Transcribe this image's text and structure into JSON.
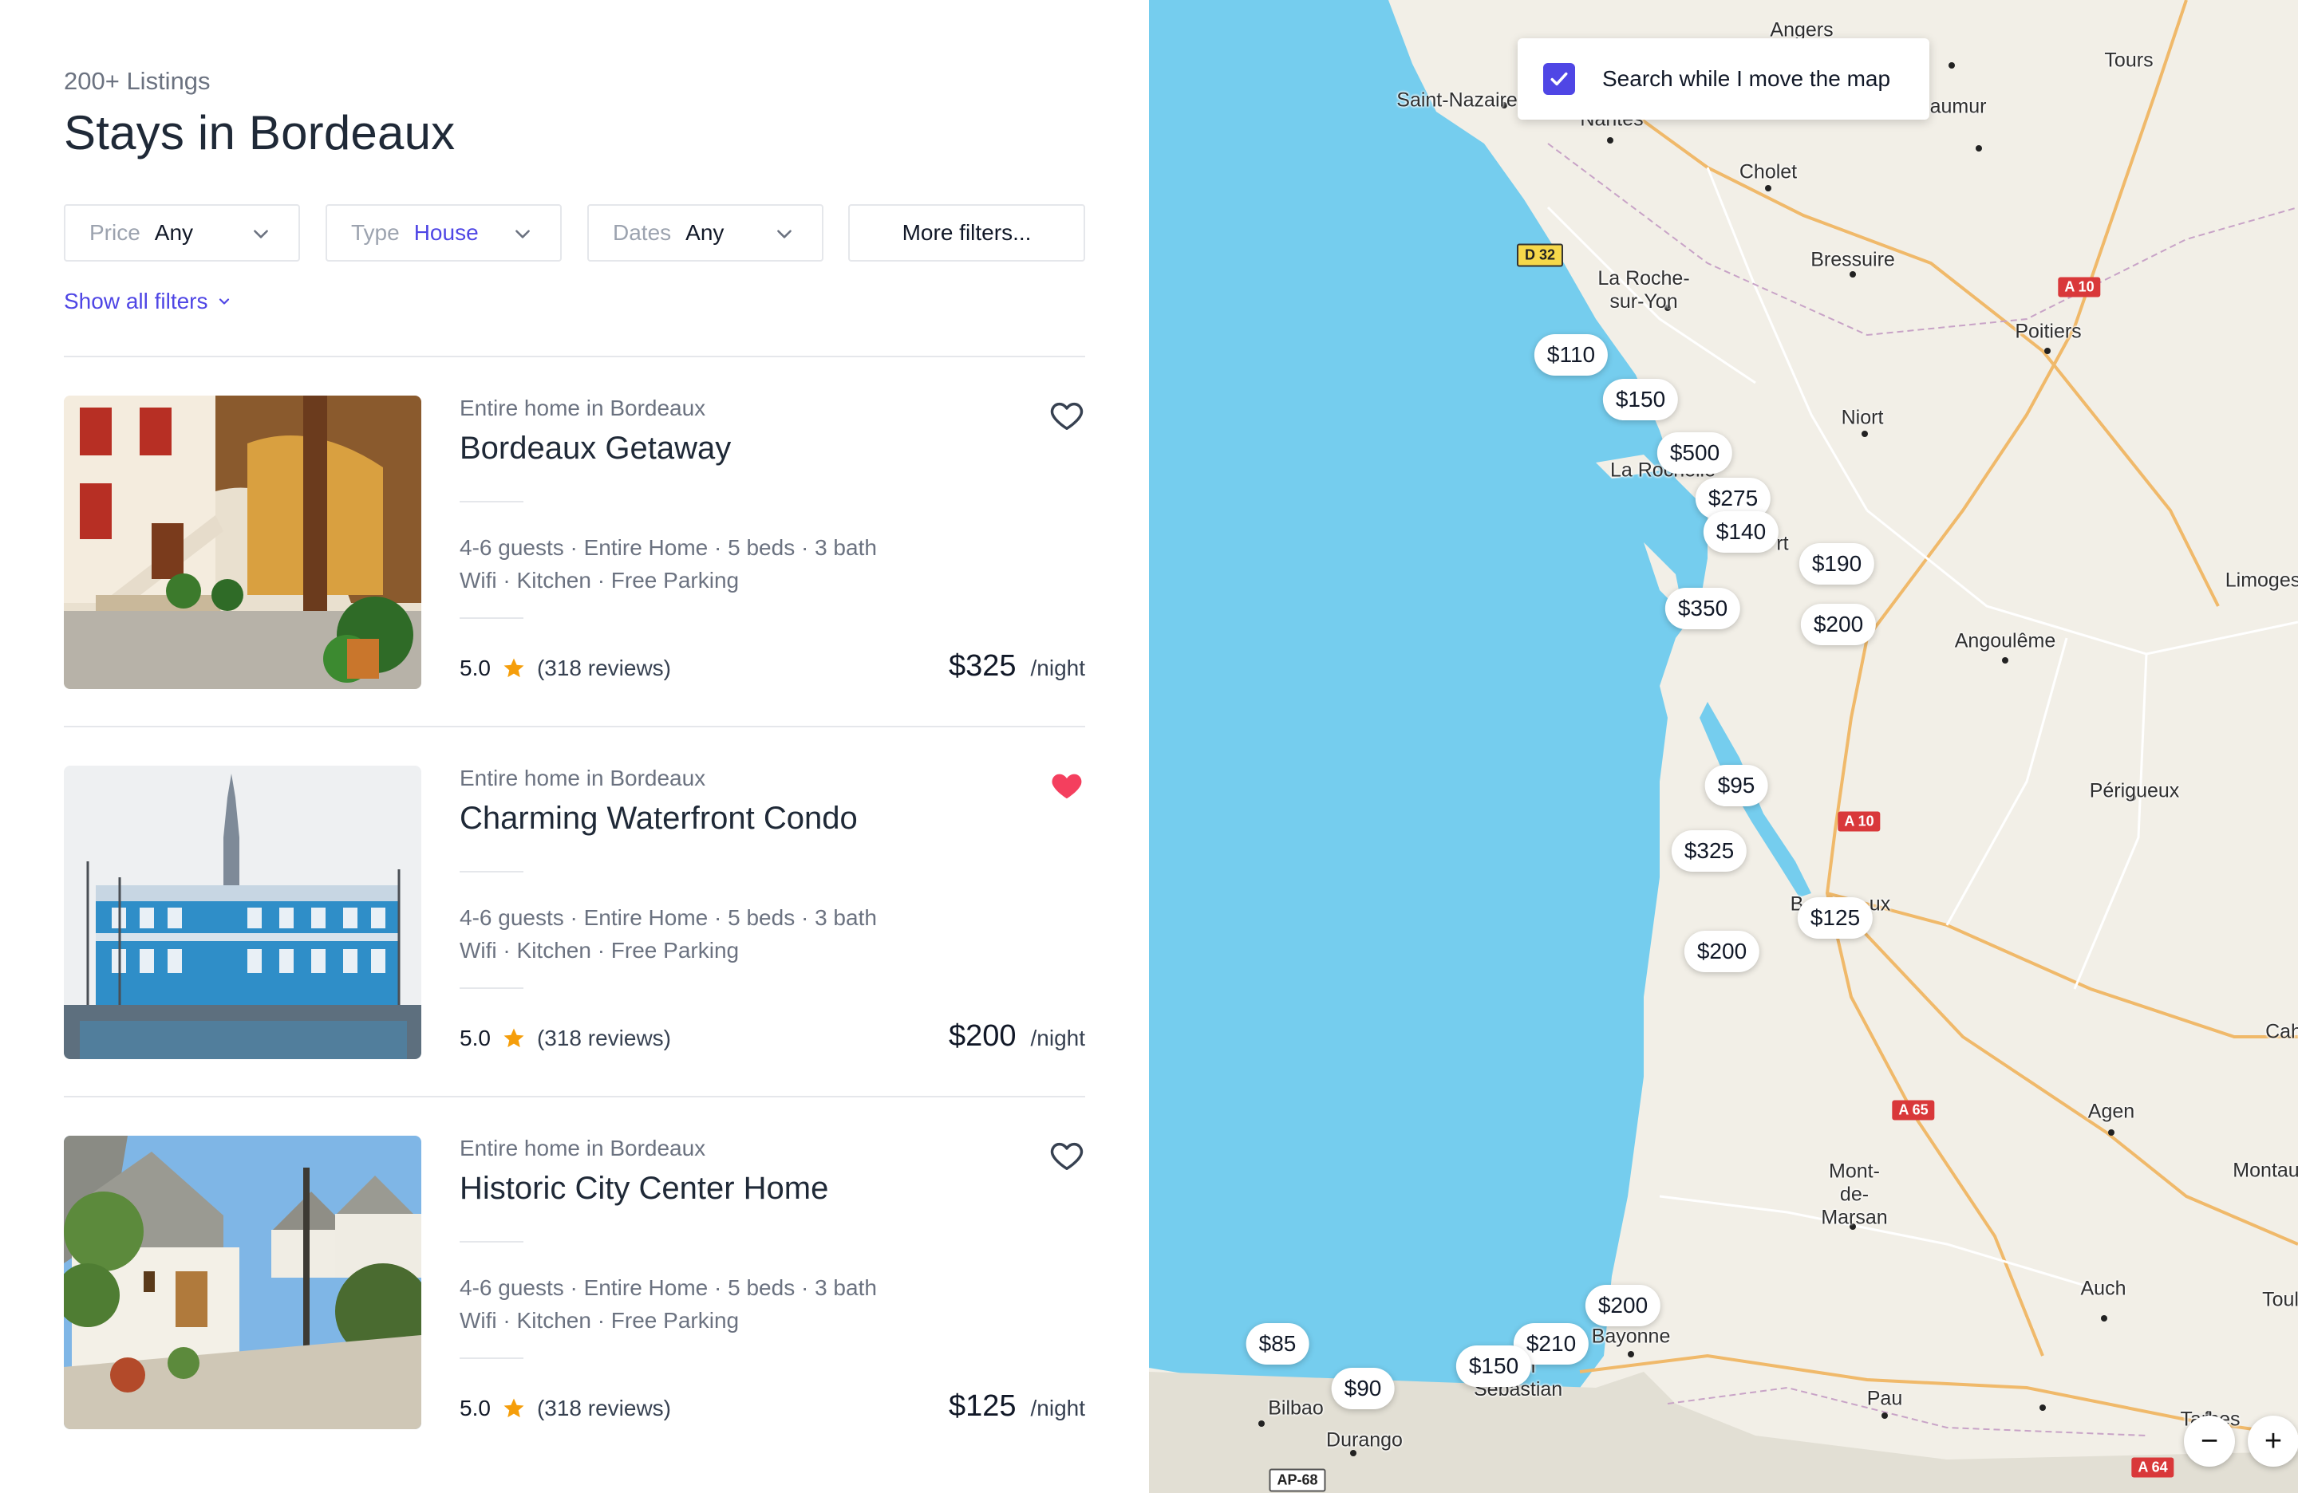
{
  "header": {
    "count": "200+ Listings",
    "title": "Stays in Bordeaux"
  },
  "filters": [
    {
      "key": "Price",
      "value": "Any"
    },
    {
      "key": "Type",
      "value": "House"
    },
    {
      "key": "Dates",
      "value": "Any"
    }
  ],
  "more_filters_label": "More filters...",
  "show_all_filters_label": "Show all filters",
  "listings": [
    {
      "subtitle": "Entire home in Bordeaux",
      "name": "Bordeaux Getaway",
      "specs": "4-6 guests · Entire Home · 5 beds · 3 bath",
      "amenities": "Wifi · Kitchen · Free Parking",
      "rating": "5.0",
      "reviews": "(318 reviews)",
      "price": "$325",
      "unit": "/night",
      "favorited": false
    },
    {
      "subtitle": "Entire home in Bordeaux",
      "name": "Charming Waterfront Condo",
      "specs": "4-6 guests · Entire Home · 5 beds · 3 bath",
      "amenities": "Wifi · Kitchen · Free Parking",
      "rating": "5.0",
      "reviews": "(318 reviews)",
      "price": "$200",
      "unit": "/night",
      "favorited": true
    },
    {
      "subtitle": "Entire home in Bordeaux",
      "name": "Historic City Center Home",
      "specs": "4-6 guests · Entire Home · 5 beds · 3 bath",
      "amenities": "Wifi · Kitchen · Free Parking",
      "rating": "5.0",
      "reviews": "(318 reviews)",
      "price": "$125",
      "unit": "/night",
      "favorited": false
    }
  ],
  "map": {
    "search_toggle": {
      "label": "Search while I move the map",
      "checked": true
    },
    "price_pins": [
      "$110",
      "$150",
      "$500",
      "$275",
      "$140",
      "$190",
      "$350",
      "$200",
      "$95",
      "$325",
      "$125",
      "$200",
      "$200",
      "$210",
      "$150",
      "$85",
      "$90"
    ],
    "places": [
      "Angers",
      "Tours",
      "Saint-Nazaire",
      "Nantes",
      "aumur",
      "Cholet",
      "Bressuire",
      "La Roche-sur-Yon",
      "Poitiers",
      "Niort",
      "La Rochelle",
      "rt",
      "Limoges",
      "Angoulême",
      "Périgueux",
      "B",
      "ux",
      "Cah",
      "Agen",
      "Mont-de-Marsan",
      "Montau",
      "Auch",
      "Toul",
      "Bayonne",
      "San Sebastian",
      "Bilbao",
      "Durango",
      "Pau",
      "Tarbes"
    ],
    "roads": [
      "D 32",
      "A 10",
      "A 10",
      "A 65",
      "A 64",
      "AP-68"
    ],
    "zoom_out": "−",
    "zoom_in": "+",
    "colors": {
      "water": "#75cdee",
      "land": "#f2efe7",
      "pin_bg": "#ffffff",
      "accent": "#4f46e5",
      "heart": "#f43f5e",
      "star": "#f59e0b"
    }
  }
}
